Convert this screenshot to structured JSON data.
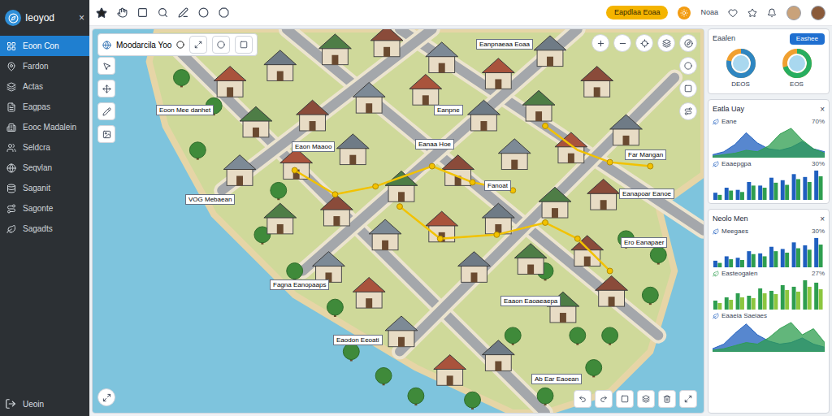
{
  "app": {
    "name": "Ieoyod",
    "close": "×"
  },
  "sidebar": {
    "items": [
      {
        "label": "Eoon Con",
        "selected": true
      },
      {
        "label": "Fardon",
        "selected": false
      },
      {
        "label": "Actas",
        "selected": false
      },
      {
        "label": "Eagpas",
        "selected": false
      },
      {
        "label": "Eooc Madalein",
        "selected": false
      },
      {
        "label": "Seldcra",
        "selected": false
      },
      {
        "label": "Seqvlan",
        "selected": false
      },
      {
        "label": "Saganit",
        "selected": false
      },
      {
        "label": "Sagonte",
        "selected": false
      },
      {
        "label": "Sagadts",
        "selected": false
      }
    ],
    "footer": "Ueoin"
  },
  "toolbar": {
    "badge": "Eapdlaa Eoaa",
    "user": "Noaa"
  },
  "map": {
    "title": "Moodarcila Yoo",
    "labels": [
      "Eoon Mee danhet",
      "Eaon Maaoo",
      "Eanaa Hoe",
      "Eanpnaeaa Eoaa",
      "Eanpne",
      "Far Mangan",
      "VOG Mebaean",
      "Fanoat",
      "Eanapoar Eanoe",
      "Ero Eanapaer",
      "Fagna Eanopaaps",
      "Eaaon Eaoaeaepa",
      "Eaodon Eeoati",
      "Ab Ear Eaoean"
    ]
  },
  "summary": {
    "title": "Eaalen",
    "button": "Eashee",
    "donuts": [
      {
        "label": "DEOS",
        "level": 0.78,
        "color": "#2e86c1"
      },
      {
        "label": "EOS",
        "level": 0.7,
        "color": "#27ae60"
      }
    ]
  },
  "cards": [
    {
      "title": "Eatla Uay",
      "close": "×",
      "rows": [
        {
          "label": "Eane",
          "reading": "70%",
          "kind": "area",
          "series": [
            {
              "color": "#1f5fbf",
              "values": [
                4,
                8,
                18,
                34,
                20,
                12,
                10,
                14,
                22,
                12,
                8
              ]
            },
            {
              "color": "#2e9e4f",
              "values": [
                2,
                4,
                6,
                10,
                8,
                16,
                32,
                40,
                24,
                12,
                6
              ]
            }
          ]
        },
        {
          "label": "Eaaepgpa",
          "reading": "30%",
          "kind": "bars",
          "series": [
            {
              "color": "#1f5fbf",
              "values": [
                20,
                34,
                28,
                50,
                40,
                62,
                55,
                72,
                64,
                82
              ]
            },
            {
              "color": "#2e9e4f",
              "values": [
                14,
                26,
                22,
                40,
                34,
                48,
                42,
                58,
                50,
                66
              ]
            }
          ]
        }
      ]
    },
    {
      "title": "Neolo Men",
      "close": "×",
      "rows": [
        {
          "label": "Meegaes",
          "reading": "30%",
          "kind": "bars",
          "series": [
            {
              "color": "#1f5fbf",
              "values": [
                18,
                30,
                26,
                44,
                38,
                56,
                50,
                68,
                60,
                80
              ]
            },
            {
              "color": "#2e9e4f",
              "values": [
                12,
                22,
                20,
                36,
                30,
                44,
                40,
                52,
                48,
                62
              ]
            }
          ]
        },
        {
          "label": "Easteogalen",
          "reading": "27%",
          "kind": "bars",
          "series": [
            {
              "color": "#2e9e4f",
              "values": [
                22,
                30,
                40,
                34,
                52,
                46,
                60,
                56,
                72,
                66
              ]
            },
            {
              "color": "#8cc63f",
              "values": [
                16,
                24,
                30,
                28,
                40,
                38,
                48,
                44,
                56,
                50
              ]
            }
          ]
        },
        {
          "label": "Eaaeia Saeiaes",
          "reading": "",
          "kind": "area",
          "series": [
            {
              "color": "#1f5fbf",
              "values": [
                4,
                10,
                24,
                36,
                22,
                14,
                10,
                12,
                18,
                10,
                6
              ]
            },
            {
              "color": "#2e9e4f",
              "values": [
                2,
                4,
                8,
                12,
                10,
                18,
                30,
                38,
                22,
                30,
                12
              ]
            }
          ]
        }
      ]
    }
  ]
}
